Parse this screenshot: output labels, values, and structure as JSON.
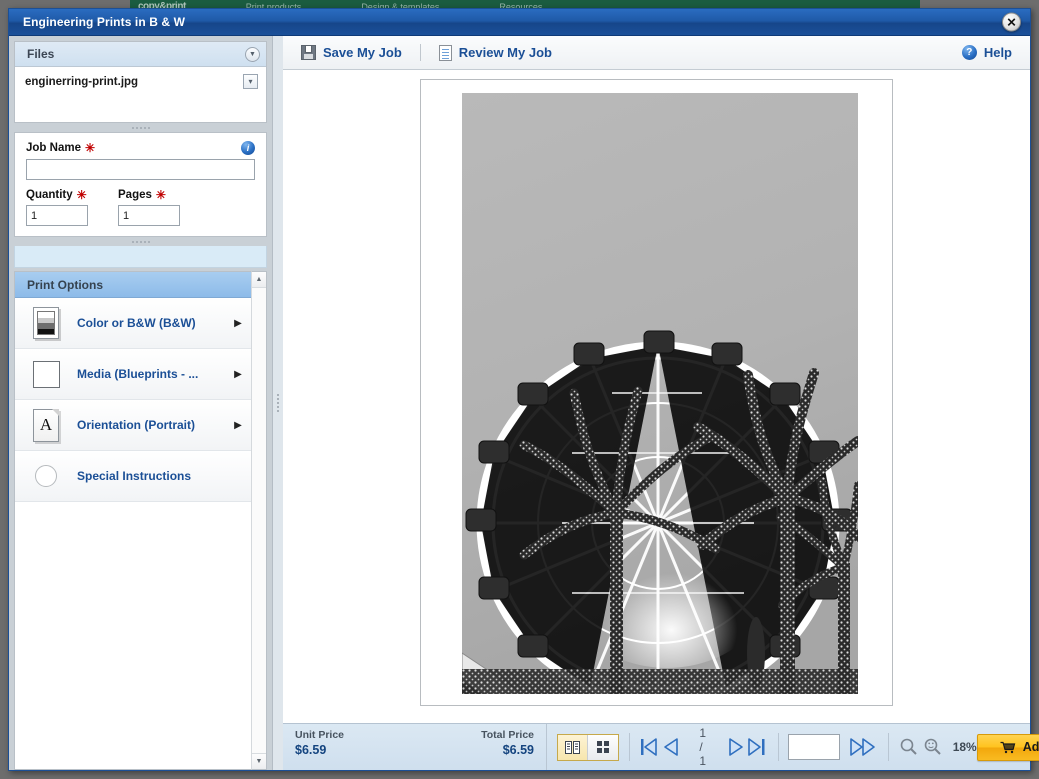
{
  "background": {
    "logo_text": "copy&print",
    "nav_items": [
      "Print products",
      "Design & templates",
      "Resources"
    ]
  },
  "modal": {
    "title": "Engineering Prints in B & W",
    "close_icon": "close-icon"
  },
  "files_panel": {
    "title": "Files",
    "collapse_icon": "chevron-down-icon",
    "files": [
      {
        "name": "enginerring-print.jpg",
        "menu_icon": "chevron-down-icon"
      }
    ]
  },
  "job_panel": {
    "job_name_label": "Job Name",
    "job_name_value": "",
    "job_name_placeholder": "",
    "required_marker": "✳",
    "info_icon": "info-icon",
    "quantity_label": "Quantity",
    "quantity_value": "1",
    "pages_label": "Pages",
    "pages_value": "1"
  },
  "print_options": {
    "header": "Print Options",
    "items": [
      {
        "label": "Color or B&W (B&W)",
        "icon": "bw-page-icon",
        "arrow": "▶"
      },
      {
        "label": "Media (Blueprints - ...",
        "icon": "media-sheet-icon",
        "arrow": "▶"
      },
      {
        "label": "Orientation (Portrait)",
        "icon": "orientation-portrait-icon",
        "arrow": "▶"
      },
      {
        "label": "Special Instructions",
        "icon": "circle-icon",
        "arrow": ""
      }
    ],
    "scroll_up_icon": "▲",
    "scroll_down_icon": "▼"
  },
  "toolbar": {
    "save_label": "Save My Job",
    "save_icon": "save-icon",
    "review_label": "Review My Job",
    "review_icon": "document-icon",
    "help_label": "Help",
    "help_icon": "help-icon"
  },
  "preview": {
    "alt": "Black and white photo of a ferris wheel behind palm trees"
  },
  "statusbar": {
    "unit_price_label": "Unit Price",
    "unit_price_value": "$6.59",
    "total_price_label": "Total Price",
    "total_price_value": "$6.59",
    "view_single_icon": "single-page-view-icon",
    "view_grid_icon": "grid-view-icon",
    "first_page_icon": "first-page-icon",
    "prev_page_icon": "previous-page-icon",
    "page_indicator": "1 / 1",
    "next_page_icon": "next-page-icon",
    "last_page_icon": "last-page-icon",
    "goto_page_value": "",
    "fast_forward_icon": "fast-forward-icon",
    "zoom_out_icon": "zoom-out-icon",
    "zoom_in_icon": "zoom-in-icon",
    "zoom_level": "18%",
    "add_to_cart_label": "Add to Cart",
    "cart_icon": "cart-icon"
  },
  "colors": {
    "titlebar_blue": "#1f5aa8",
    "link_blue": "#1b4f96",
    "accent_yellow": "#ffc31f",
    "price_blue": "#14447f",
    "required_red": "#c00000",
    "header_green": "#1b5c40"
  }
}
